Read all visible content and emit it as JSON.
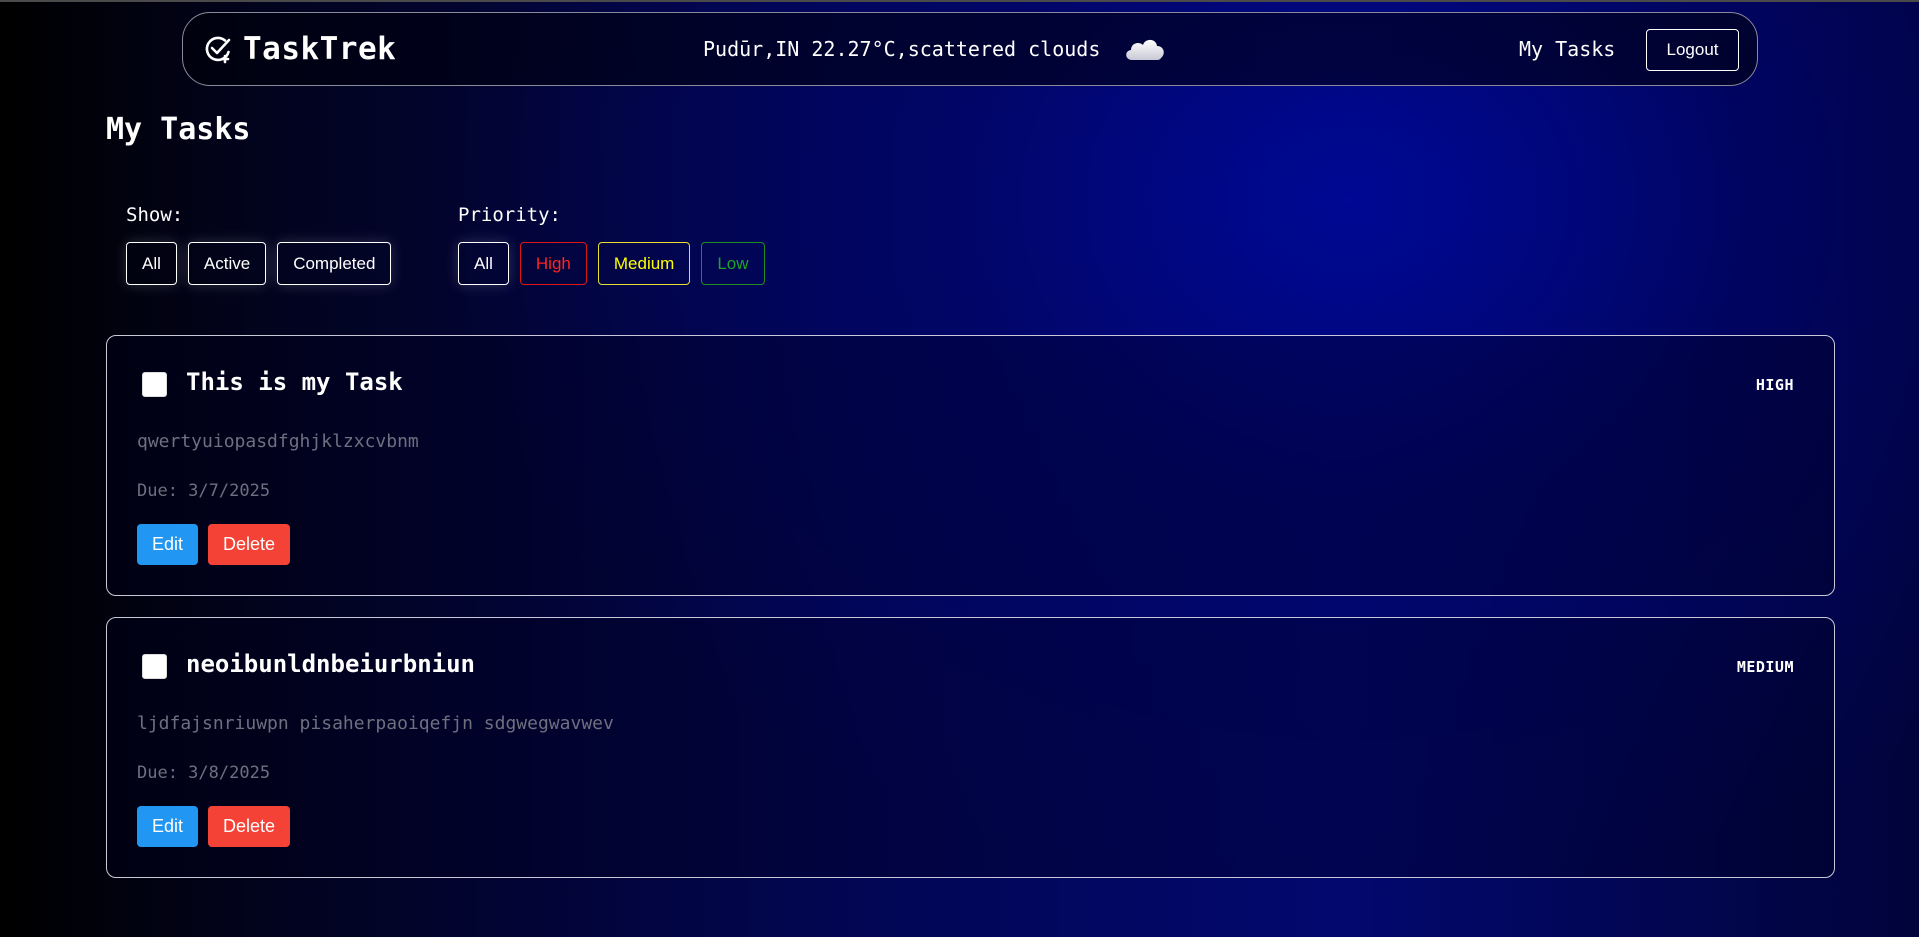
{
  "header": {
    "brand": "TaskTrek",
    "weather": "Pudūr,IN 22.27°C,scattered clouds",
    "weather_icon": "cloud-icon",
    "nav_link": "My Tasks",
    "logout_label": "Logout"
  },
  "page": {
    "title": "My Tasks"
  },
  "filters": {
    "show": {
      "label": "Show:",
      "options": [
        "All",
        "Active",
        "Completed"
      ]
    },
    "priority": {
      "label": "Priority:",
      "options": [
        "All",
        "High",
        "Medium",
        "Low"
      ],
      "colors": {
        "High": "#ff2323",
        "Medium": "#ffff00",
        "Low": "#1fa324"
      }
    }
  },
  "tasks": [
    {
      "title": "This is my Task",
      "priority": "HIGH",
      "description": "qwertyuiopasdfghjklzxcvbnm",
      "due": "Due: 3/7/2025",
      "completed": false,
      "edit_label": "Edit",
      "delete_label": "Delete"
    },
    {
      "title": "neoibunldnbeiurbniun",
      "priority": "MEDIUM",
      "description": "ljdfajsnriuwpn pisaherpaoiqefjn sdgwegwavwev",
      "due": "Due: 3/8/2025",
      "completed": false,
      "edit_label": "Edit",
      "delete_label": "Delete"
    }
  ],
  "colors": {
    "edit": "#2196f3",
    "delete": "#f44336",
    "muted_text": "#6f6f7f"
  }
}
